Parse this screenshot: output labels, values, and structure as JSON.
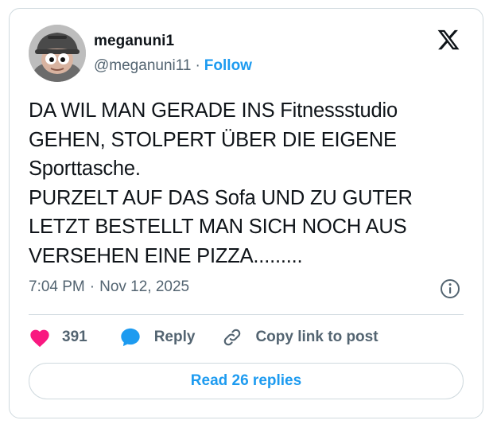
{
  "tweet": {
    "author": {
      "display_name": "meganuni1",
      "handle": "@meganuni11",
      "follow_label": "Follow",
      "separator": "·"
    },
    "text": "DA WIL MAN GERADE INS Fitnessstudio\nGEHEN, STOLPERT ÜBER DIE EIGENE\nSporttasche.\nPURZELT AUF DAS Sofa UND ZU GUTER\nLETZT BESTELLT MAN SICH NOCH AUS\nVERSEHEN EINE PIZZA.........",
    "time": "7:04 PM",
    "date": "Nov 12, 2025",
    "meta_separator": "·",
    "likes": "391",
    "reply_label": "Reply",
    "copy_link_label": "Copy link to post",
    "read_replies_label": "Read 26 replies"
  },
  "colors": {
    "accent": "#1d9bf0",
    "like": "#f91880",
    "muted": "#536471",
    "text": "#0f1419",
    "border": "#cfd9de"
  },
  "icons": {
    "brand": "x-logo-icon",
    "info": "info-icon",
    "like": "heart-icon",
    "reply": "speech-bubble-icon",
    "copy": "link-icon"
  }
}
